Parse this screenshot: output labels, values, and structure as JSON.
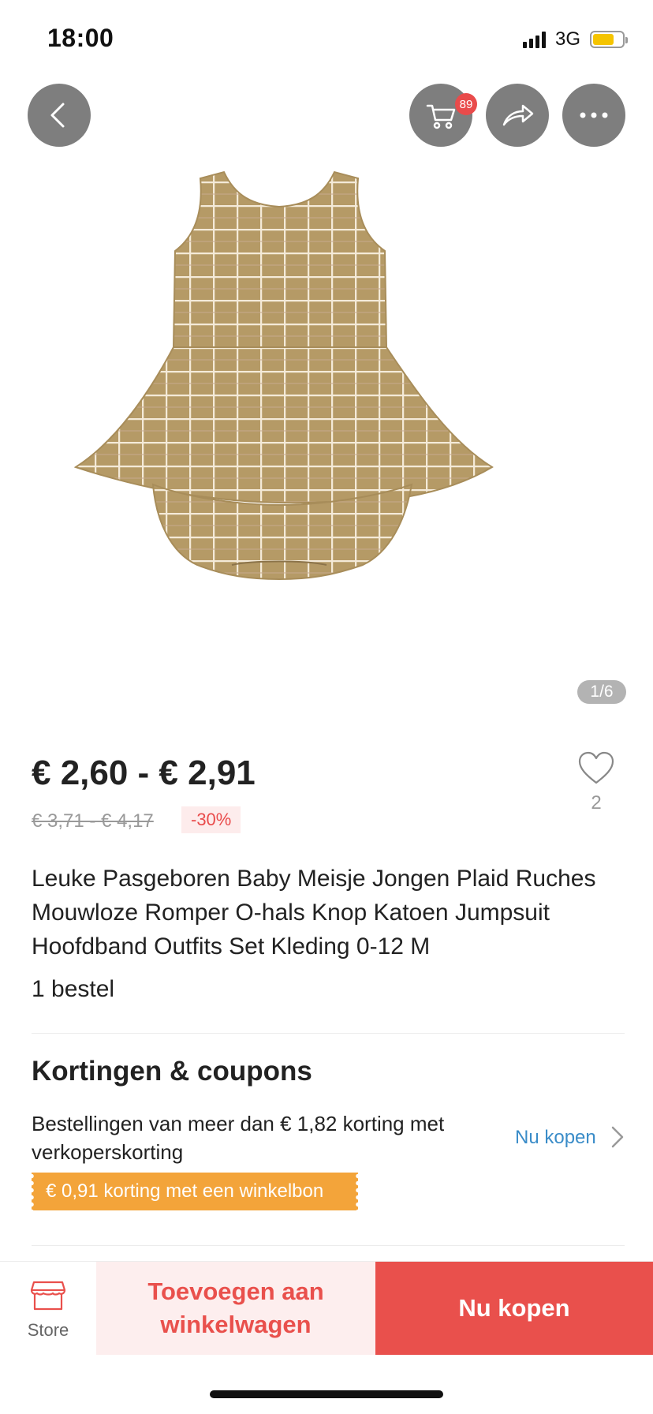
{
  "status_bar": {
    "time": "18:00",
    "network": "3G",
    "battery_color": "#f5c400"
  },
  "header": {
    "back_icon": "chevron-left-icon",
    "cart_icon": "cart-icon",
    "cart_badge": "89",
    "share_icon": "share-icon",
    "more_icon": "more-dots-icon"
  },
  "gallery": {
    "counter": "1/6",
    "pattern_color": "#b59a66"
  },
  "product": {
    "price_range": "€ 2,60 - € 2,91",
    "original_price": "€ 3,71 - € 4,17",
    "discount": "-30%",
    "wishlist_count": "2",
    "title": "Leuke Pasgeboren Baby Meisje Jongen Plaid Ruches Mouwloze Romper O-hals Knop Katoen Jumpsuit Hoofdband Outfits Set Kleding 0-12 M",
    "orders": "1 bestel"
  },
  "coupons": {
    "section_title": "Kortingen & coupons",
    "discount_text": "Bestellingen van meer dan € 1,82 korting met verkoperskorting",
    "link_label": "Nu kopen",
    "store_coupon": "€ 0,91 korting met een winkelbon"
  },
  "bottom_bar": {
    "store_label": "Store",
    "add_to_cart": "Toevoegen aan winkelwagen",
    "buy_now": "Nu kopen",
    "accent_color": "#e9504c"
  }
}
